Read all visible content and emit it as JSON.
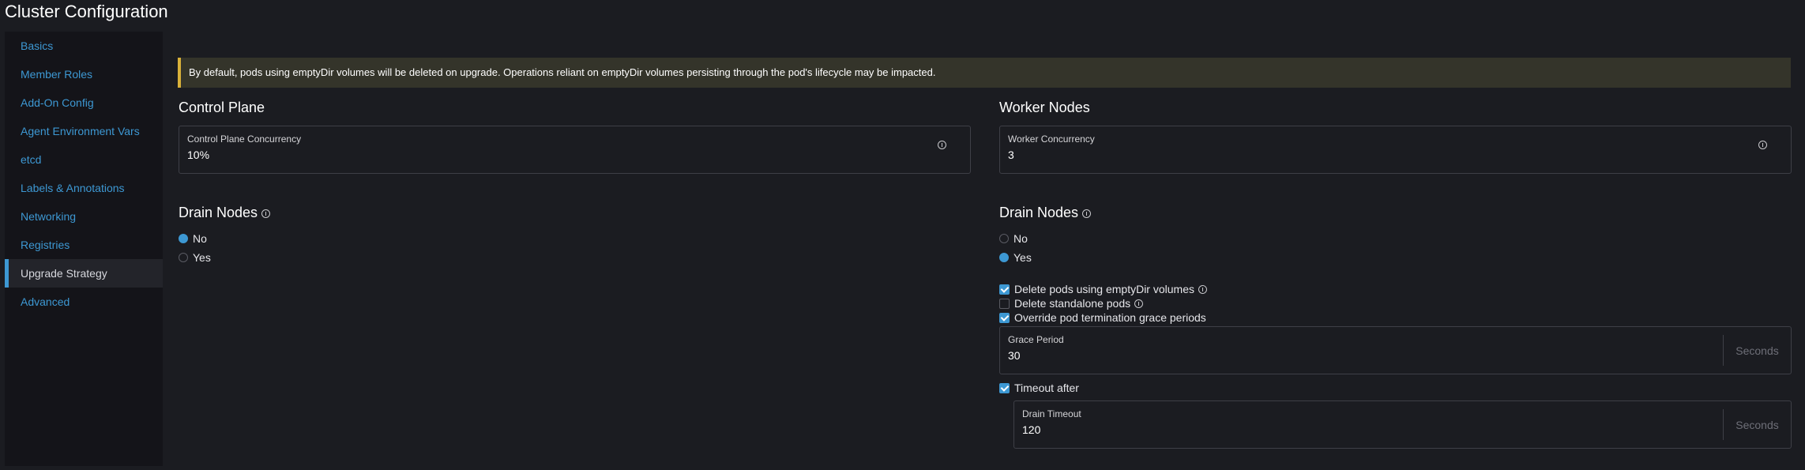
{
  "page": {
    "title": "Cluster Configuration"
  },
  "sidebar": {
    "items": [
      {
        "label": "Basics"
      },
      {
        "label": "Member Roles"
      },
      {
        "label": "Add-On Config"
      },
      {
        "label": "Agent Environment Vars"
      },
      {
        "label": "etcd"
      },
      {
        "label": "Labels & Annotations"
      },
      {
        "label": "Networking"
      },
      {
        "label": "Registries"
      },
      {
        "label": "Upgrade Strategy",
        "active": true
      },
      {
        "label": "Advanced"
      }
    ]
  },
  "banner": {
    "text": "By default, pods using emptyDir volumes will be deleted on upgrade. Operations reliant on emptyDir volumes persisting through the pod's lifecycle may be impacted."
  },
  "control_plane": {
    "title": "Control Plane",
    "concurrency_label": "Control Plane Concurrency",
    "concurrency_value": "10%",
    "drain_title": "Drain Nodes",
    "drain_options": [
      "No",
      "Yes"
    ],
    "drain_selected": "No"
  },
  "worker_nodes": {
    "title": "Worker Nodes",
    "concurrency_label": "Worker Concurrency",
    "concurrency_value": "3",
    "drain_title": "Drain Nodes",
    "drain_options": [
      "No",
      "Yes"
    ],
    "drain_selected": "Yes",
    "delete_empty_dir_label": "Delete pods using emptyDir volumes",
    "delete_standalone_label": "Delete standalone pods",
    "override_grace_label": "Override pod termination grace periods",
    "grace_period_label": "Grace Period",
    "grace_period_value": "30",
    "grace_period_suffix": "Seconds",
    "timeout_after_label": "Timeout after",
    "drain_timeout_label": "Drain Timeout",
    "drain_timeout_value": "120",
    "drain_timeout_suffix": "Seconds"
  },
  "colors": {
    "accent": "#3d98d3",
    "warning": "#d9b13a",
    "background": "#1b1c21"
  }
}
